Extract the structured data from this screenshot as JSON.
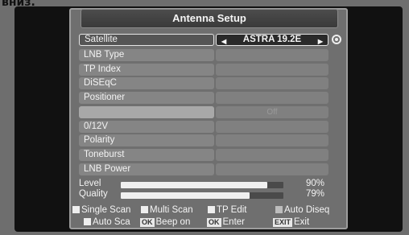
{
  "caption": "вниз.",
  "title": "Antenna Setup",
  "rows": [
    {
      "label": "Satellite",
      "value": "ASTRA 19.2E",
      "prev_icon": "◀",
      "next_icon": "▶"
    },
    {
      "label": "LNB Type",
      "value": ""
    },
    {
      "label": "TP Index",
      "value": ""
    },
    {
      "label": "DiSEqC",
      "value": ""
    },
    {
      "label": "Positioner",
      "value": ""
    },
    {
      "label": "",
      "value": "Off"
    },
    {
      "label": "0/12V",
      "value": ""
    },
    {
      "label": "Polarity",
      "value": ""
    },
    {
      "label": "Toneburst",
      "value": ""
    },
    {
      "label": "LNB Power",
      "value": ""
    }
  ],
  "meters": {
    "level": {
      "label": "Level",
      "percent_text": "90%",
      "percent": 90
    },
    "quality": {
      "label": "Quality",
      "percent_text": "79%",
      "percent": 79
    }
  },
  "legend": {
    "single_scan": "Single Scan",
    "multi_scan": "Multi Scan",
    "tp_edit": "TP Edit",
    "auto_diseq": "Auto Diseq",
    "auto_scan": "Auto Sca",
    "beep_key": "OK",
    "beep_on": "Beep on",
    "enter_key": "OK",
    "enter": "Enter",
    "exit_key": "EXIT",
    "exit": "Exit"
  }
}
